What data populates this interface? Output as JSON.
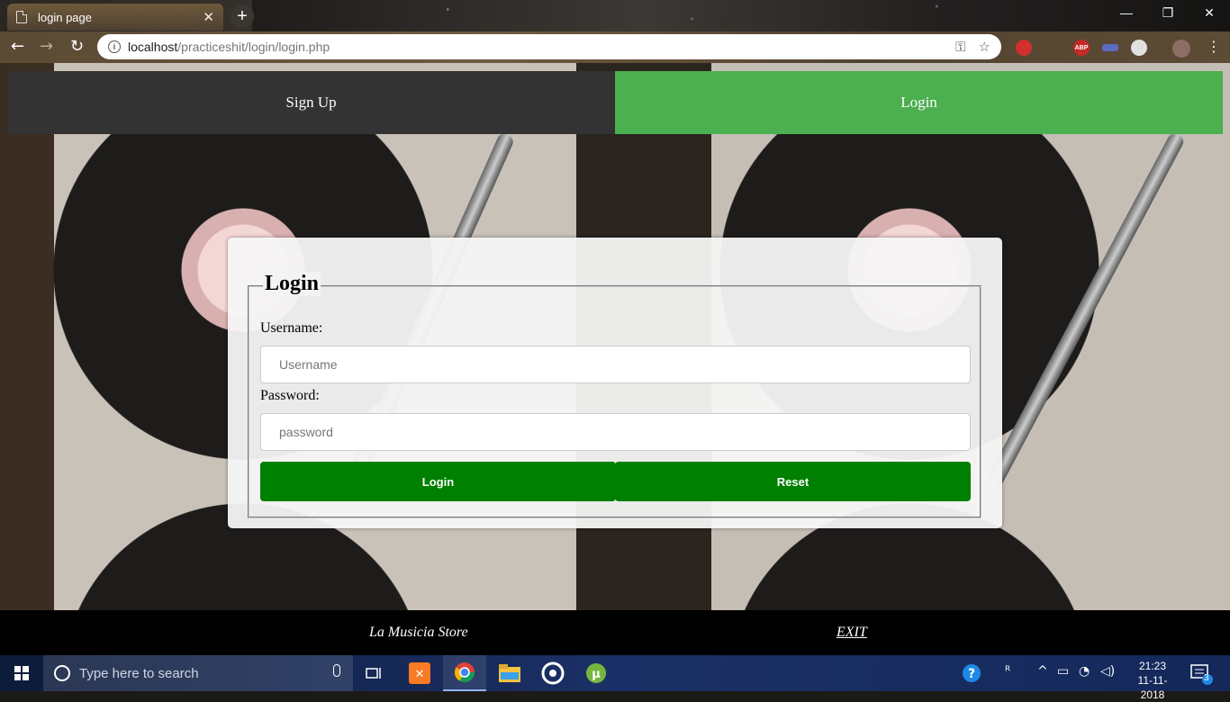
{
  "browser": {
    "tab_title": "login page",
    "tab_close": "✕",
    "new_tab": "+",
    "url_host": "localhost",
    "url_path": "/practiceshit/login/login.php",
    "window_controls": [
      "—",
      "❐",
      "✕"
    ],
    "extension_abp": "ABP"
  },
  "nav": {
    "signup_label": "Sign Up",
    "login_label": "Login",
    "active_tab": "Login",
    "active_color": "#4caf50"
  },
  "form": {
    "legend": "Login",
    "username_label": "Username:",
    "username_placeholder": "Username",
    "password_label": "Password:",
    "password_placeholder": "password",
    "login_button": "Login",
    "reset_button": "Reset",
    "button_color": "#008000"
  },
  "footer": {
    "store_name": "La Musicia Store",
    "exit_label": "EXIT"
  },
  "taskbar": {
    "search_placeholder": "Type here to search",
    "time": "21:23",
    "date": "11-11-2018",
    "notification_count": "3"
  }
}
